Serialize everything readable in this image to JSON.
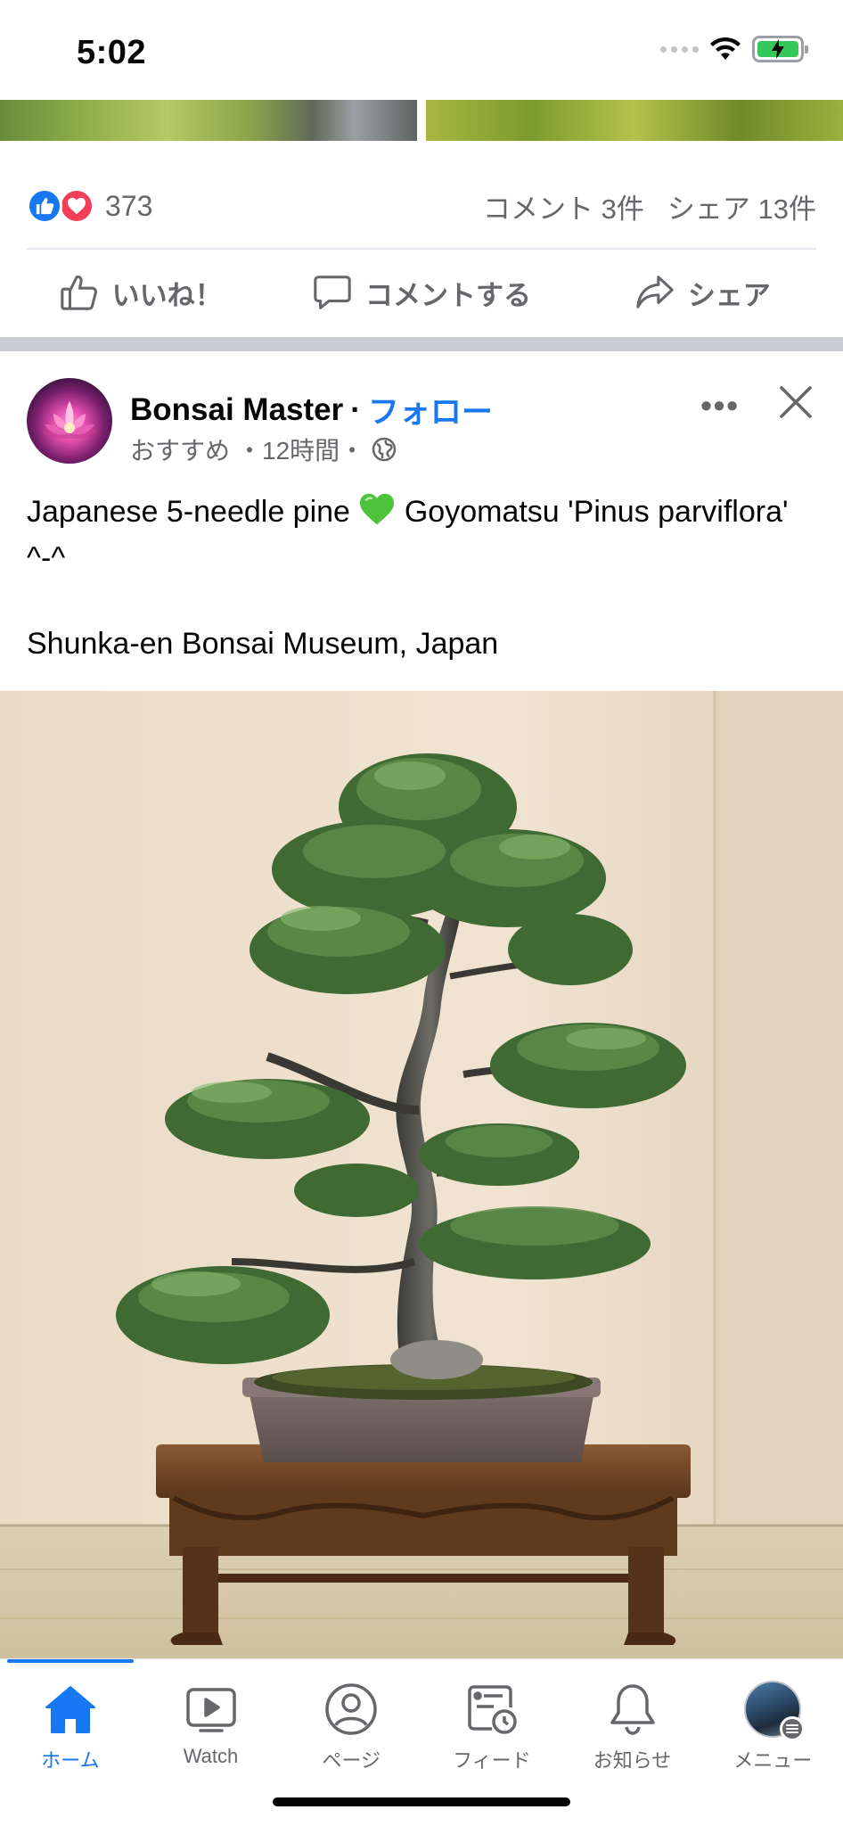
{
  "status_bar": {
    "time": "5:02"
  },
  "previous_post": {
    "reaction_count": "373",
    "comments": "コメント 3件",
    "shares": "シェア 13件",
    "actions": {
      "like": "いいね！",
      "comment": "コメントする",
      "share": "シェア"
    }
  },
  "post": {
    "author": "Bonsai Master",
    "separator": "·",
    "follow": "フォロー",
    "meta_recommended": "おすすめ",
    "meta_time": "・12時間・",
    "text_line1_pre": "Japanese 5-needle pine ",
    "text_line1_post": " Goyomatsu 'Pinus parviflora' ^-^",
    "text_line2": "Shunka-en Bonsai Museum, Japan",
    "image_icon": "bonsai-pine-photo"
  },
  "bottom_nav": {
    "items": [
      {
        "label": "ホーム",
        "icon": "home-icon",
        "active": true
      },
      {
        "label": "Watch",
        "icon": "watch-icon",
        "active": false
      },
      {
        "label": "ページ",
        "icon": "pages-icon",
        "active": false
      },
      {
        "label": "フィード",
        "icon": "feeds-icon",
        "active": false
      },
      {
        "label": "お知らせ",
        "icon": "bell-icon",
        "active": false
      },
      {
        "label": "メニュー",
        "icon": "menu-avatar",
        "active": false
      }
    ]
  },
  "colors": {
    "accent": "#1877f2",
    "secondary_text": "#65676b",
    "love": "#f33e58"
  }
}
